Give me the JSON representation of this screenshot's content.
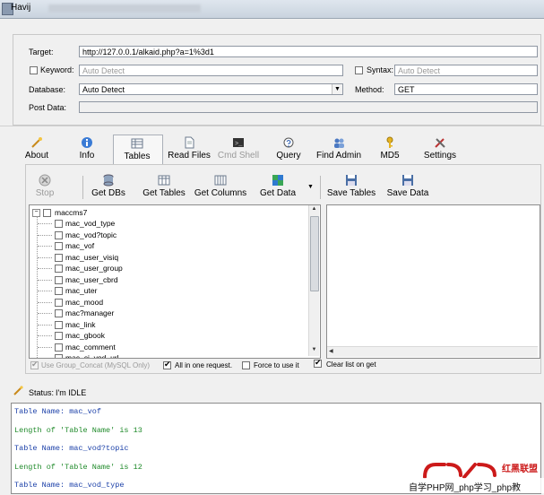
{
  "window": {
    "title": "Havij"
  },
  "form": {
    "target_label": "Target:",
    "target_value": "http://127.0.0.1/alkaid.php?a=1%3d1",
    "keyword_label": "Keyword:",
    "keyword_value": "Auto Detect",
    "syntax_label": "Syntax:",
    "syntax_value": "Auto Detect",
    "database_label": "Database:",
    "database_value": "Auto Detect",
    "method_label": "Method:",
    "method_value": "GET",
    "postdata_label": "Post Data:",
    "postdata_value": ""
  },
  "toolbar": {
    "items": [
      {
        "label": "About",
        "icon": "wand-icon"
      },
      {
        "label": "Info",
        "icon": "info-icon"
      },
      {
        "label": "Tables",
        "icon": "table-icon"
      },
      {
        "label": "Read Files",
        "icon": "file-icon"
      },
      {
        "label": "Cmd Shell",
        "icon": "terminal-icon"
      },
      {
        "label": "Query",
        "icon": "query-icon"
      },
      {
        "label": "Find Admin",
        "icon": "users-icon"
      },
      {
        "label": "MD5",
        "icon": "key-icon"
      },
      {
        "label": "Settings",
        "icon": "tools-icon"
      }
    ]
  },
  "actions": {
    "stop": "Stop",
    "get_dbs": "Get DBs",
    "get_tables": "Get Tables",
    "get_columns": "Get Columns",
    "get_data": "Get Data",
    "save_tables": "Save Tables",
    "save_data": "Save Data"
  },
  "tree": {
    "root": "maccms7",
    "items": [
      "mac_vod_type",
      "mac_vod?topic",
      "mac_vof",
      "mac_user_visiq",
      "mac_user_group",
      "mac_user_cbrd",
      "mac_uter",
      "mac_mood",
      "mac?manager",
      "mac_link",
      "mac_gbook",
      "mac_comment",
      "mac_ci_vod_url"
    ]
  },
  "options": {
    "group_concat": "Use Group_Concat (MySQL Only)",
    "all_in_one": "All in one request.",
    "force": "Force to use it",
    "clear_list": "Clear list on get"
  },
  "status": {
    "label": "Status:",
    "value": "I'm IDLE"
  },
  "log": {
    "lines": [
      {
        "text": "Table Name: mac_vof",
        "kind": "name"
      },
      {
        "text": "Length of 'Table Name' is 13",
        "kind": "len"
      },
      {
        "text": "Table Name: mac_vod?topic",
        "kind": "name"
      },
      {
        "text": "Length of 'Table Name' is 12",
        "kind": "len"
      },
      {
        "text": "Table Name: mac_vod_type",
        "kind": "name"
      }
    ]
  },
  "watermark": {
    "brand": "红黑联盟",
    "caption": "自学PHP网_php学习_php教"
  },
  "colors": {
    "log_name": "#1a3fa8",
    "log_length": "#1f8a2a",
    "watermark": "#cc1a1a"
  }
}
